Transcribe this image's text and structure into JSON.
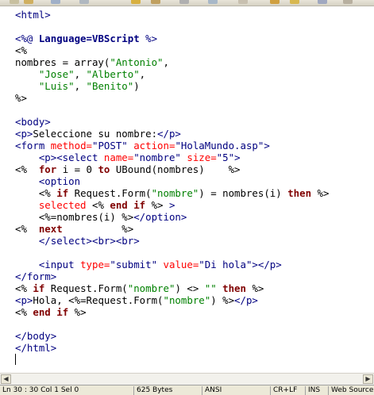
{
  "code": [
    [
      {
        "t": "<html>",
        "c": "tag"
      }
    ],
    [],
    [
      {
        "t": "<%@ ",
        "c": "tag"
      },
      {
        "t": "Language",
        "c": "dir"
      },
      {
        "t": "=VBScript",
        "c": "dir"
      },
      {
        "t": " %>",
        "c": "tag"
      }
    ],
    [
      {
        "t": "<%",
        "c": "plain"
      }
    ],
    [
      {
        "t": "nombres = array(",
        "c": "plain"
      },
      {
        "t": "\"Antonio\"",
        "c": "str"
      },
      {
        "t": ",",
        "c": "plain"
      }
    ],
    [
      {
        "t": "    ",
        "c": "plain"
      },
      {
        "t": "\"Jose\"",
        "c": "str"
      },
      {
        "t": ", ",
        "c": "plain"
      },
      {
        "t": "\"Alberto\"",
        "c": "str"
      },
      {
        "t": ",",
        "c": "plain"
      }
    ],
    [
      {
        "t": "    ",
        "c": "plain"
      },
      {
        "t": "\"Luis\"",
        "c": "str"
      },
      {
        "t": ", ",
        "c": "plain"
      },
      {
        "t": "\"Benito\"",
        "c": "str"
      },
      {
        "t": ")",
        "c": "plain"
      }
    ],
    [
      {
        "t": "%>",
        "c": "plain"
      }
    ],
    [],
    [
      {
        "t": "<body>",
        "c": "tag"
      }
    ],
    [
      {
        "t": "<p>",
        "c": "tag"
      },
      {
        "t": "Seleccione su nombre:",
        "c": "txt"
      },
      {
        "t": "</p>",
        "c": "tag"
      }
    ],
    [
      {
        "t": "<form ",
        "c": "tag"
      },
      {
        "t": "method=",
        "c": "attr"
      },
      {
        "t": "\"POST\"",
        "c": "tag"
      },
      {
        "t": " action=",
        "c": "attr"
      },
      {
        "t": "\"HolaMundo.asp\"",
        "c": "tag"
      },
      {
        "t": ">",
        "c": "tag"
      }
    ],
    [
      {
        "t": "    ",
        "c": "plain"
      },
      {
        "t": "<p><select ",
        "c": "tag"
      },
      {
        "t": "name=",
        "c": "attr"
      },
      {
        "t": "\"nombre\"",
        "c": "tag"
      },
      {
        "t": " size=",
        "c": "attr"
      },
      {
        "t": "\"5\"",
        "c": "tag"
      },
      {
        "t": ">",
        "c": "tag"
      }
    ],
    [
      {
        "t": "<%  ",
        "c": "plain"
      },
      {
        "t": "for",
        "c": "kw"
      },
      {
        "t": " i = 0 ",
        "c": "plain"
      },
      {
        "t": "to",
        "c": "kw"
      },
      {
        "t": " UBound(nombres)    %>",
        "c": "plain"
      }
    ],
    [
      {
        "t": "    ",
        "c": "plain"
      },
      {
        "t": "<option",
        "c": "tag"
      }
    ],
    [
      {
        "t": "    ",
        "c": "plain"
      },
      {
        "t": "<% ",
        "c": "plain"
      },
      {
        "t": "if",
        "c": "kw"
      },
      {
        "t": " Request.Form(",
        "c": "plain"
      },
      {
        "t": "\"nombre\"",
        "c": "str"
      },
      {
        "t": ") = nombres(i) ",
        "c": "plain"
      },
      {
        "t": "then",
        "c": "kw"
      },
      {
        "t": " %>",
        "c": "plain"
      }
    ],
    [
      {
        "t": "    ",
        "c": "plain"
      },
      {
        "t": "selected",
        "c": "attr"
      },
      {
        "t": " <% ",
        "c": "plain"
      },
      {
        "t": "end if",
        "c": "kw"
      },
      {
        "t": " %> ",
        "c": "plain"
      },
      {
        "t": ">",
        "c": "tag"
      }
    ],
    [
      {
        "t": "    ",
        "c": "plain"
      },
      {
        "t": "<%=nombres(i) %>",
        "c": "plain"
      },
      {
        "t": "</option>",
        "c": "tag"
      }
    ],
    [
      {
        "t": "<%  ",
        "c": "plain"
      },
      {
        "t": "next",
        "c": "kw"
      },
      {
        "t": "          %>",
        "c": "plain"
      }
    ],
    [
      {
        "t": "    ",
        "c": "plain"
      },
      {
        "t": "</select><br><br>",
        "c": "tag"
      }
    ],
    [],
    [
      {
        "t": "    ",
        "c": "plain"
      },
      {
        "t": "<input ",
        "c": "tag"
      },
      {
        "t": "type=",
        "c": "attr"
      },
      {
        "t": "\"submit\"",
        "c": "tag"
      },
      {
        "t": " value=",
        "c": "attr"
      },
      {
        "t": "\"Di hola\"",
        "c": "tag"
      },
      {
        "t": "></p>",
        "c": "tag"
      }
    ],
    [
      {
        "t": "</form>",
        "c": "tag"
      }
    ],
    [
      {
        "t": "<% ",
        "c": "plain"
      },
      {
        "t": "if",
        "c": "kw"
      },
      {
        "t": " Request.Form(",
        "c": "plain"
      },
      {
        "t": "\"nombre\"",
        "c": "str"
      },
      {
        "t": ") <> ",
        "c": "plain"
      },
      {
        "t": "\"\"",
        "c": "str"
      },
      {
        "t": " ",
        "c": "plain"
      },
      {
        "t": "then",
        "c": "kw"
      },
      {
        "t": " %>",
        "c": "plain"
      }
    ],
    [
      {
        "t": "<p>",
        "c": "tag"
      },
      {
        "t": "Hola, ",
        "c": "txt"
      },
      {
        "t": "<%=Request.Form(",
        "c": "plain"
      },
      {
        "t": "\"nombre\"",
        "c": "str"
      },
      {
        "t": ") %>",
        "c": "plain"
      },
      {
        "t": "</p>",
        "c": "tag"
      }
    ],
    [
      {
        "t": "<% ",
        "c": "plain"
      },
      {
        "t": "end if",
        "c": "kw"
      },
      {
        "t": " %>",
        "c": "plain"
      }
    ],
    [],
    [
      {
        "t": "</body>",
        "c": "tag"
      }
    ],
    [
      {
        "t": "</html>",
        "c": "tag"
      }
    ],
    []
  ],
  "colors": {
    "tag": "#000080",
    "attr": "#ff0000",
    "string": "#008000",
    "keyword": "#800000",
    "background": "#ffffff"
  },
  "status_bar": {
    "position": "Ln 30 : 30  Col 1  Sel 0",
    "size": "625 Bytes",
    "encoding": "ANSI",
    "line_endings": "CR+LF",
    "insert_mode": "INS",
    "language": "Web Source"
  }
}
